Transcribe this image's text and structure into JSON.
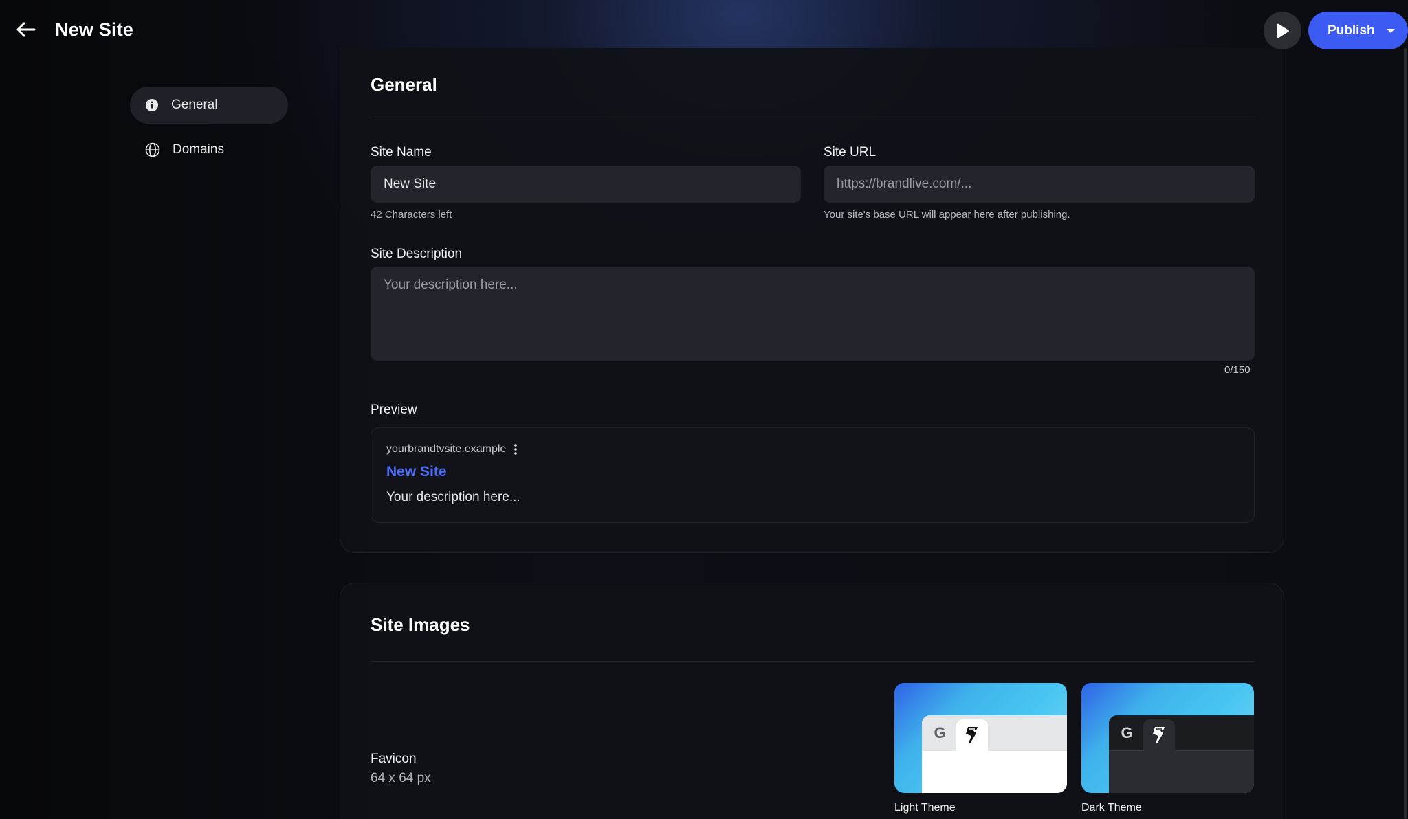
{
  "header": {
    "title": "New Site",
    "publish_label": "Publish"
  },
  "sidebar": {
    "items": [
      {
        "label": "General",
        "icon": "info-icon",
        "active": true
      },
      {
        "label": "Domains",
        "icon": "globe-icon",
        "active": false
      }
    ]
  },
  "general": {
    "title": "General",
    "site_name": {
      "label": "Site Name",
      "value": "New Site",
      "helper": "42 Characters left"
    },
    "site_url": {
      "label": "Site URL",
      "placeholder": "https://brandlive.com/...",
      "helper": "Your site's base URL will appear here after publishing."
    },
    "site_description": {
      "label": "Site Description",
      "placeholder": "Your description here...",
      "counter": "0/150"
    },
    "preview": {
      "label": "Preview",
      "domain": "yourbrandtvsite.example",
      "title": "New Site",
      "description": "Your description here..."
    }
  },
  "site_images": {
    "title": "Site Images",
    "favicon_label": "Favicon",
    "favicon_size": "64 x 64 px",
    "themes": [
      {
        "name": "Light Theme",
        "tab_letter": "G"
      },
      {
        "name": "Dark Theme",
        "tab_letter": "G"
      }
    ]
  },
  "colors": {
    "accent": "#3b5bf2",
    "link": "#4a6cf7",
    "background": "#0b0c10",
    "card": "#101117",
    "input": "#23252c"
  }
}
